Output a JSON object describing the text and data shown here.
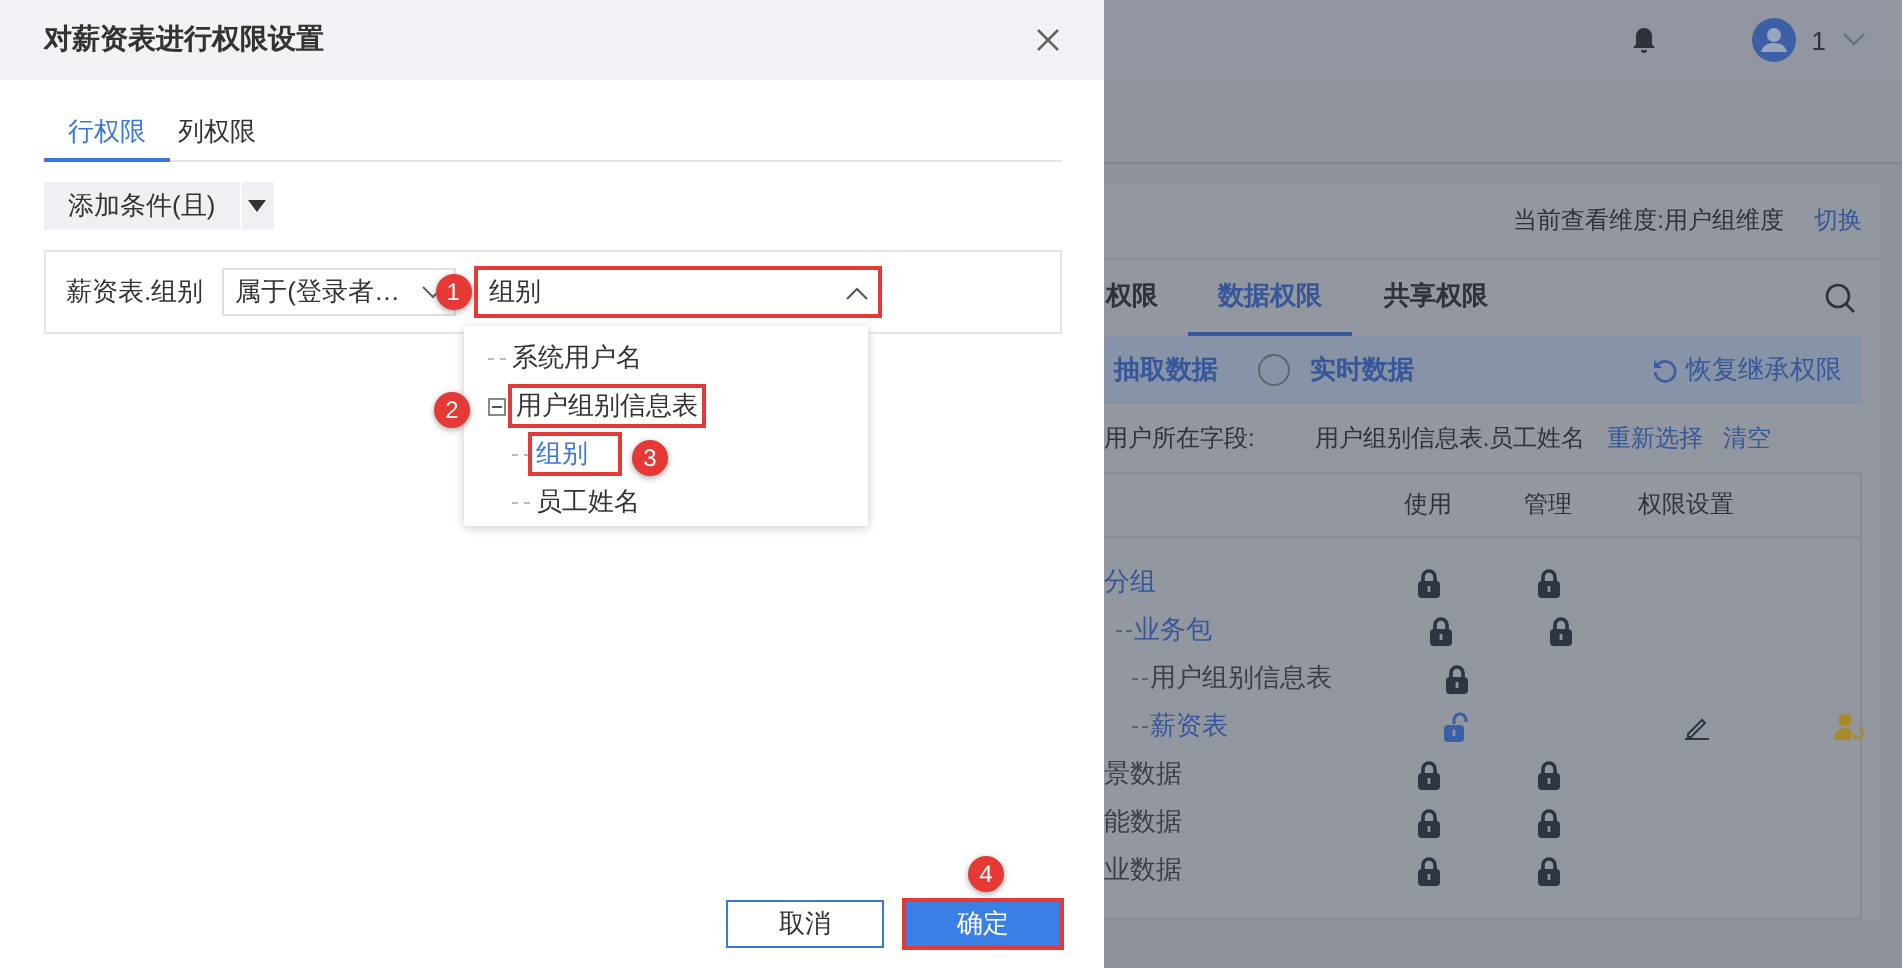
{
  "background": {
    "top_bar": {
      "user": "1"
    },
    "view_dimension": {
      "label": "当前查看维度:用户组维度",
      "action": "切换"
    },
    "tabs": [
      {
        "label": "权限",
        "selected": false
      },
      {
        "label": "数据权限",
        "selected": true
      },
      {
        "label": "共享权限",
        "selected": false
      }
    ],
    "mode_options": [
      {
        "kind": "label",
        "label": "抽取数据"
      },
      {
        "kind": "radio",
        "label": "实时数据",
        "selected": false
      }
    ],
    "restore_button": "恢复继承权限",
    "field": {
      "label": "用户所在字段:",
      "value": "用户组别信息表.员工姓名",
      "links": [
        "重新选择",
        "清空"
      ]
    },
    "columns": [
      "使用",
      "管理",
      "权限设置"
    ],
    "rows": [
      {
        "name": "分组",
        "link": true,
        "use_locked": true,
        "manage_locked": true,
        "children": [
          {
            "name": "业务包",
            "link": true,
            "use_locked": true,
            "manage_locked": true,
            "children": [
              {
                "name": "用户组别信息表",
                "link": false,
                "use_locked": true
              },
              {
                "name": "薪资表",
                "link": true,
                "use_locked": false,
                "editable": true,
                "custom": true
              }
            ]
          }
        ]
      },
      {
        "name": "景数据",
        "link": false,
        "use_locked": true,
        "manage_locked": true
      },
      {
        "name": "能数据",
        "link": false,
        "use_locked": true,
        "manage_locked": true
      },
      {
        "name": "业数据",
        "link": false,
        "use_locked": true,
        "manage_locked": true
      }
    ]
  },
  "dialog": {
    "title": "对薪资表进行权限设置",
    "tabs": [
      {
        "label": "行权限",
        "selected": true
      },
      {
        "label": "列权限",
        "selected": false
      }
    ],
    "add_condition": "添加条件(且)",
    "condition": {
      "field": "薪资表.组别",
      "operator": "属于(登录者…",
      "value": "组别",
      "expanded": true,
      "callout": "1"
    },
    "options": [
      {
        "label": "系统用户名",
        "selected": false
      },
      {
        "label": "用户组别信息表",
        "selected": false,
        "expanded": true,
        "callout": "2",
        "children": [
          {
            "label": "组别",
            "selected": true,
            "callout": "3"
          },
          {
            "label": "员工姓名",
            "selected": false
          }
        ]
      }
    ],
    "buttons": [
      {
        "label": "取消",
        "kind": "secondary"
      },
      {
        "label": "确定",
        "kind": "primary",
        "callout": "4"
      }
    ]
  }
}
